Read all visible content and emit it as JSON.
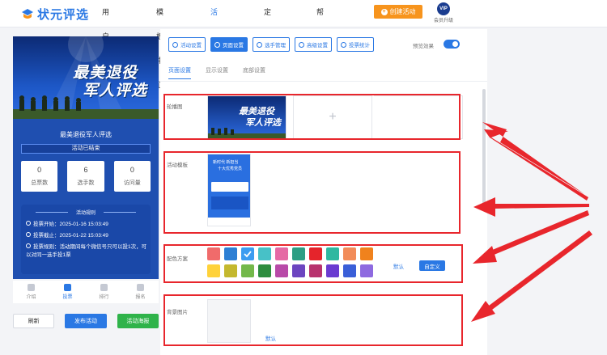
{
  "app": {
    "name": "状元评选"
  },
  "nav": {
    "items": [
      "用户首页",
      "模板中心",
      "活动管理",
      "定制服务",
      "帮助中心"
    ],
    "active_index": 2,
    "create_label": "创建活动",
    "vip_badge": "VIP",
    "vip_label": "会员升级"
  },
  "preview": {
    "banner_line1": "最美退役",
    "banner_line2": "军人评选",
    "title": "最美退役军人评选",
    "status": "活动已结束",
    "stats": [
      {
        "value": "0",
        "label": "总票数"
      },
      {
        "value": "6",
        "label": "选手数"
      },
      {
        "value": "0",
        "label": "访问量"
      }
    ],
    "rules_header": "活动规则",
    "rules": [
      "投票开始：2025-01-16 15:03:49",
      "投票截止：2025-01-22 15:03:49",
      "投票规则：活动期间每个微信号只可以投1次，可以对同一选手投1票"
    ],
    "tabs": [
      "介绍",
      "投票",
      "排行",
      "报名"
    ],
    "active_tab": 1,
    "buttons": {
      "refresh": "刷新",
      "publish": "发布活动",
      "poster": "活动海报"
    }
  },
  "settings": {
    "toolbar": [
      "活动设置",
      "页面设置",
      "选手管理",
      "高级设置",
      "投票统计"
    ],
    "active_tool": 1,
    "preview_effect_label": "预览效果",
    "subtabs": [
      "页面设置",
      "显示设置",
      "底部设置"
    ],
    "active_subtab": 0,
    "rows": {
      "carousel_label": "轮播图",
      "carousel_banner_line1": "最美退役",
      "carousel_banner_line2": "军人评选",
      "plus": "+",
      "template_label": "活动模板",
      "template_caption1": "新时代 新担当",
      "template_caption2": "十大优秀党员",
      "color_label": "配色方案",
      "default_link": "默认",
      "custom_button": "自定义",
      "bg_label": "背景图片",
      "bg_default_link": "默认"
    },
    "colors_row1": [
      "#f06b6b",
      "#2d7fd4",
      "#3b9cf0",
      "#47c1c7",
      "#e56aa4",
      "#2d9e84",
      "#e5242b",
      "#2fb8a0",
      "#f28c5a",
      "#f0821d"
    ],
    "colors_row2": [
      "#ffd23a",
      "#c4b82e",
      "#73b84a",
      "#2d8d3f",
      "#b84aa8",
      "#6c45c0",
      "#b8326e",
      "#6a3bd1",
      "#3a5fd8",
      "#8e6ae0"
    ],
    "selected_color": 2
  },
  "annotation": {
    "color": "#e8262c"
  }
}
